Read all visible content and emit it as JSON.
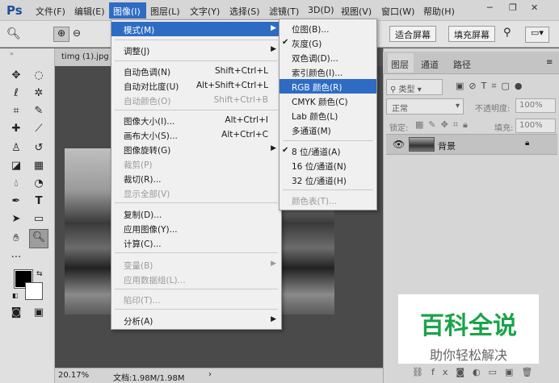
{
  "app": {
    "logo": "Ps"
  },
  "menubar": {
    "items": [
      "文件(F)",
      "编辑(E)",
      "图像(I)",
      "图层(L)",
      "文字(Y)",
      "选择(S)",
      "滤镜(T)",
      "3D(D)",
      "视图(V)",
      "窗口(W)",
      "帮助(H)"
    ],
    "active": "图像(I)"
  },
  "options": {
    "fit_screen": "适合屏幕",
    "fill_screen": "填充屏幕"
  },
  "document": {
    "tab": "timg (1).jpg",
    "zoom": "20.17%",
    "doc_info": "文档:1.98M/1.98M"
  },
  "image_menu": {
    "mode": "模式(M)",
    "adjust": "调整(J)",
    "auto_tone": "自动色调(N)",
    "auto_tone_sc": "Shift+Ctrl+L",
    "auto_contrast": "自动对比度(U)",
    "auto_contrast_sc": "Alt+Shift+Ctrl+L",
    "auto_color": "自动颜色(O)",
    "auto_color_sc": "Shift+Ctrl+B",
    "image_size": "图像大小(I)...",
    "image_size_sc": "Alt+Ctrl+I",
    "canvas_size": "画布大小(S)...",
    "canvas_size_sc": "Alt+Ctrl+C",
    "rotation": "图像旋转(G)",
    "crop": "裁剪(P)",
    "trim": "裁切(R)...",
    "reveal_all": "显示全部(V)",
    "duplicate": "复制(D)...",
    "apply_image": "应用图像(Y)...",
    "calculations": "计算(C)...",
    "variables": "变量(B)",
    "apply_data": "应用数据组(L)...",
    "trap": "陷印(T)...",
    "analysis": "分析(A)"
  },
  "mode_submenu": {
    "bitmap": "位图(B)...",
    "grayscale": "灰度(G)",
    "duotone": "双色调(D)...",
    "indexed": "索引颜色(I)...",
    "rgb": "RGB 颜色(R)",
    "cmyk": "CMYK 颜色(C)",
    "lab": "Lab 颜色(L)",
    "multichannel": "多通道(M)",
    "bits8": "8 位/通道(A)",
    "bits16": "16 位/通道(N)",
    "bits32": "32 位/通道(H)",
    "color_table": "颜色表(T)...",
    "check": "✔"
  },
  "layers_panel": {
    "tabs": [
      "图层",
      "通道",
      "路径"
    ],
    "kind_filter": "类型",
    "blend": "正常",
    "opacity_label": "不透明度:",
    "opacity": "100%",
    "lock_label": "锁定:",
    "fill_label": "填充:",
    "fill": "100%",
    "layer_name": "背景"
  },
  "watermark": {
    "title": "百科全说",
    "subtitle": "助你轻松解决"
  },
  "colors": {
    "highlight": "#2e6cc4",
    "watermark_green": "#1aa34a",
    "logo_blue": "#1c4f9c"
  }
}
